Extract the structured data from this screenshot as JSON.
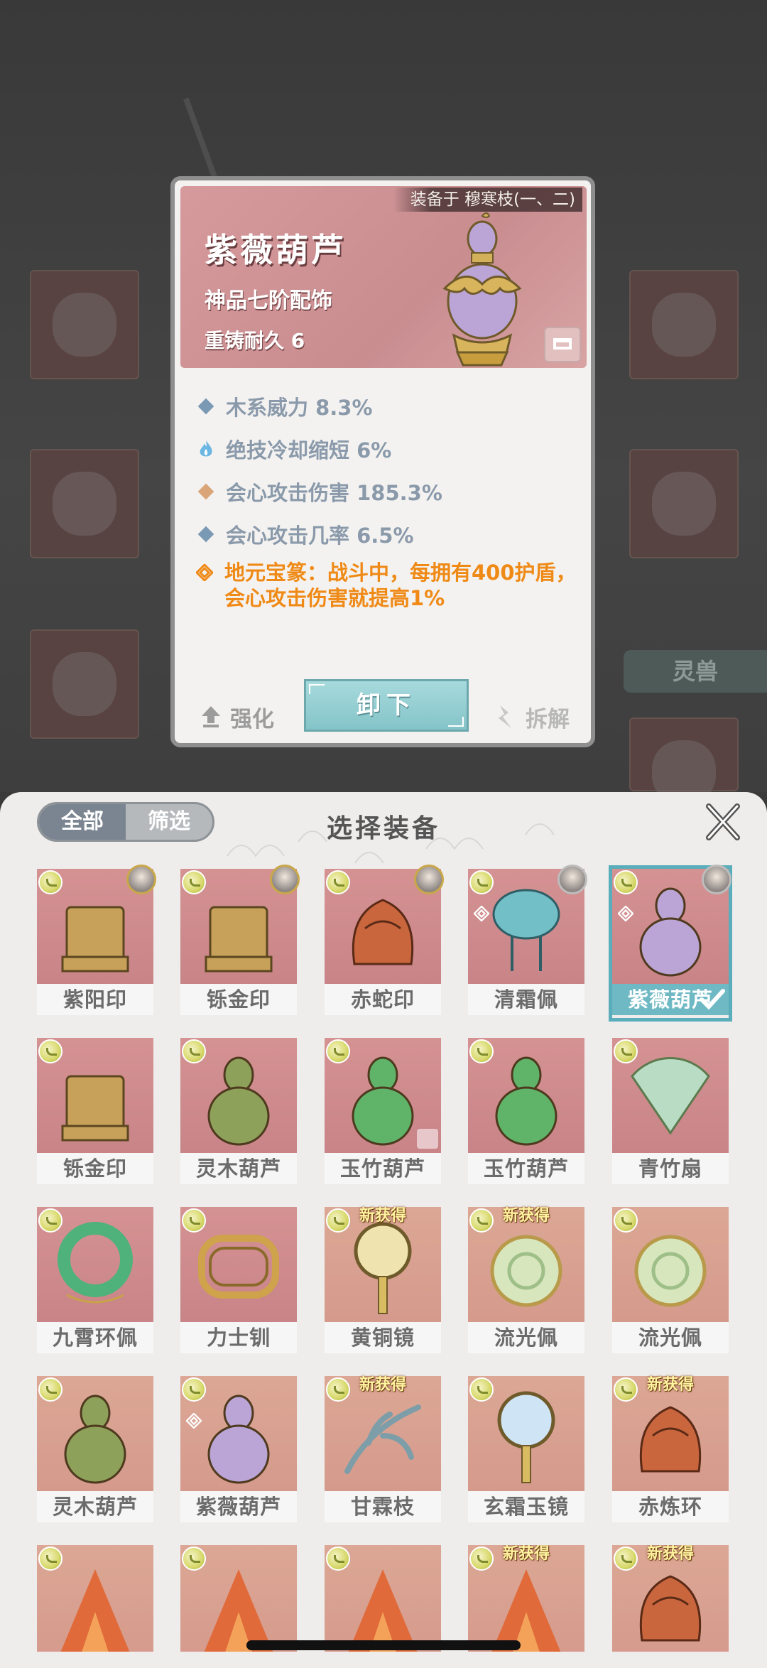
{
  "detail": {
    "equipped_by": "装备于 穆寒枝(一、二)",
    "name": "紫薇葫芦",
    "grade": "神品七阶配饰",
    "durability": "重铸耐久 6",
    "stats": [
      {
        "text": "木系威力 8.3%",
        "icon": "diamond-blue"
      },
      {
        "text": "绝技冷却缩短 6%",
        "icon": "flame-blue"
      },
      {
        "text": "会心攻击伤害 185.3%",
        "icon": "diamond-gold"
      },
      {
        "text": "会心攻击几率 6.5%",
        "icon": "diamond-blue"
      }
    ],
    "special": "地元宝篆：战斗中，每拥有400护盾，会心攻击伤害就提高1%",
    "actions": {
      "enhance": "强化",
      "unequip": "卸下",
      "dismantle": "拆解"
    }
  },
  "background": {
    "side_tab": "灵兽"
  },
  "panel": {
    "filter_all": "全部",
    "filter_screen": "筛选",
    "title": "选择装备",
    "items": [
      {
        "name": "紫阳印",
        "new": "",
        "bg": "pink",
        "avatar": "gold"
      },
      {
        "name": "铄金印",
        "new": "",
        "bg": "pink",
        "avatar": "gold"
      },
      {
        "name": "赤蛇印",
        "new": "",
        "bg": "pink",
        "avatar": "gold"
      },
      {
        "name": "清霜佩",
        "new": "",
        "bg": "pink",
        "avatar": "silver"
      },
      {
        "name": "紫薇葫芦",
        "new": "",
        "bg": "pink",
        "avatar": "silver",
        "selected": true
      },
      {
        "name": "铄金印",
        "new": "",
        "bg": "pink"
      },
      {
        "name": "灵木葫芦",
        "new": "",
        "bg": "pink"
      },
      {
        "name": "玉竹葫芦",
        "new": "",
        "bg": "pink"
      },
      {
        "name": "玉竹葫芦",
        "new": "",
        "bg": "pink"
      },
      {
        "name": "青竹扇",
        "new": "",
        "bg": "pink"
      },
      {
        "name": "九霄环佩",
        "new": "",
        "bg": "pink"
      },
      {
        "name": "力士钏",
        "new": "",
        "bg": "pink"
      },
      {
        "name": "黄铜镜",
        "new": "新获得",
        "bg": "tan"
      },
      {
        "name": "流光佩",
        "new": "新获得",
        "bg": "tan"
      },
      {
        "name": "流光佩",
        "new": "",
        "bg": "tan"
      },
      {
        "name": "灵木葫芦",
        "new": "",
        "bg": "tan"
      },
      {
        "name": "紫薇葫芦",
        "new": "",
        "bg": "tan"
      },
      {
        "name": "甘霖枝",
        "new": "新获得",
        "bg": "tan"
      },
      {
        "name": "玄霜玉镜",
        "new": "",
        "bg": "tan"
      },
      {
        "name": "赤炼环",
        "new": "新获得",
        "bg": "tan"
      },
      {
        "name": "",
        "new": "",
        "bg": "tan"
      },
      {
        "name": "",
        "new": "",
        "bg": "tan"
      },
      {
        "name": "",
        "new": "",
        "bg": "tan"
      },
      {
        "name": "",
        "new": "新获得",
        "bg": "tan"
      },
      {
        "name": "",
        "new": "新获得",
        "bg": "tan"
      }
    ]
  }
}
